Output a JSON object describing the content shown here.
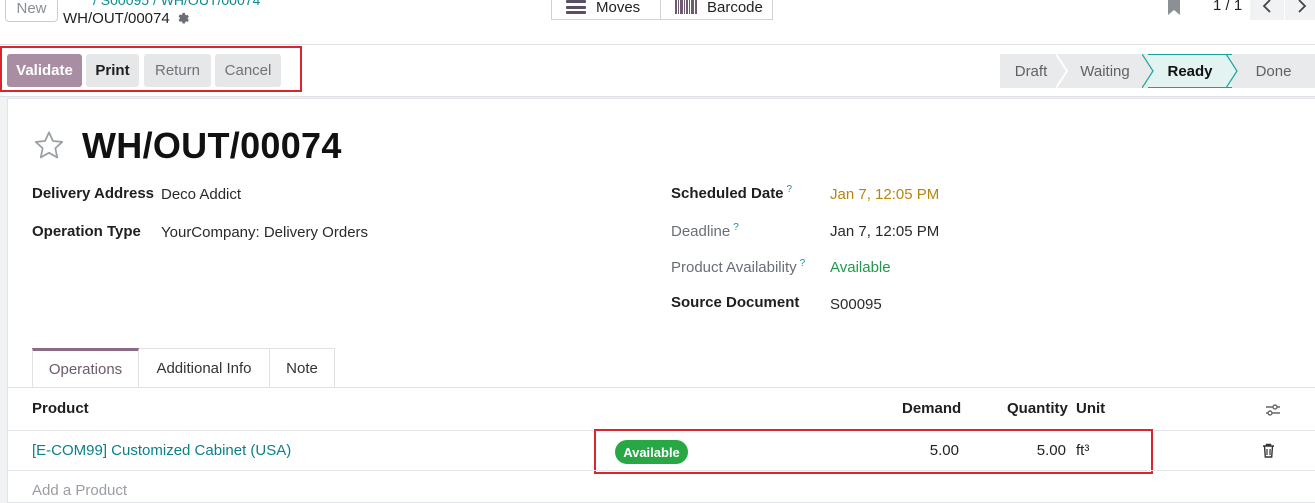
{
  "header": {
    "new_label": "New",
    "breadcrumb_partial": "/ S00095 / WH/OUT/00074",
    "record_name": "WH/OUT/00074",
    "smart_buttons": {
      "moves": "Moves",
      "barcode": "Barcode"
    },
    "pager": "1 / 1"
  },
  "actions": {
    "validate": "Validate",
    "print": "Print",
    "return": "Return",
    "cancel": "Cancel"
  },
  "stages": [
    "Draft",
    "Waiting",
    "Ready",
    "Done"
  ],
  "stage_active": "Ready",
  "form": {
    "title": "WH/OUT/00074",
    "delivery_address_label": "Delivery Address",
    "delivery_address_value": "Deco Addict",
    "operation_type_label": "Operation Type",
    "operation_type_value": "YourCompany: Delivery Orders",
    "scheduled_date_label": "Scheduled Date",
    "scheduled_date_value": "Jan 7, 12:05 PM",
    "deadline_label": "Deadline",
    "deadline_value": "Jan 7, 12:05 PM",
    "availability_label": "Product Availability",
    "availability_value": "Available",
    "source_label": "Source Document",
    "source_value": "S00095",
    "help_mark": "?"
  },
  "tabs": {
    "operations": "Operations",
    "additional": "Additional Info",
    "note": "Note"
  },
  "table": {
    "headers": {
      "product": "Product",
      "demand": "Demand",
      "quantity": "Quantity",
      "unit": "Unit"
    },
    "rows": [
      {
        "product": "[E-COM99] Customized Cabinet (USA)",
        "status": "Available",
        "demand": "5.00",
        "quantity": "5.00",
        "unit": "ft³"
      }
    ],
    "add_label": "Add a Product"
  },
  "colors": {
    "validate_bg": "#a98ea3",
    "link_teal": "#0b7f8a",
    "available_green": "#28a745",
    "highlight_red": "#d9262e",
    "active_stage_border": "#1aa39a"
  }
}
